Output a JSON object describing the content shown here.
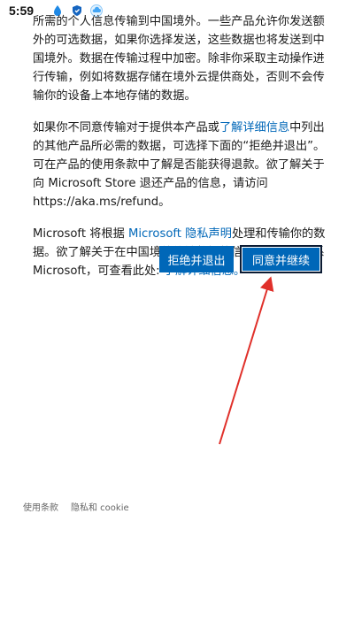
{
  "status_bar": {
    "time": "5:59",
    "icons": [
      "blue-drop-icon",
      "shield-icon",
      "cloud-badge-icon"
    ]
  },
  "content": {
    "p1": "所需的个人信息传输到中国境外。一些产品允许你发送额外的可选数据，如果你选择发送，这些数据也将发送到中国境外。数据在传输过程中加密。除非你采取主动操作进行传输，例如将数据存储在境外云提供商处，否则不会传输你的设备上本地存储的数据。",
    "p2_part1": "如果你不同意传输对于提供本产品或",
    "p2_link": "了解详细信息",
    "p2_part2": "中列出的其他产品所必需的数据，可选择下面的“拒绝并退出”。可在产品的使用条款中了解是否能获得退款。欲了解关于向 Microsoft Store 退还产品的信息，请访问 https://aka.ms/refund。",
    "p3_part1": "Microsoft 将根据 ",
    "p3_link1": "Microsoft 隐私声明",
    "p3_part2": "处理和传输你的数据。欲了解关于在中国境外传输数据的信息以及如何联系 Microsoft，可查看此处: ",
    "p3_link2": "了解详细信息。"
  },
  "buttons": {
    "decline_label": "拒绝并退出",
    "accept_label": "同意并继续"
  },
  "footer": {
    "terms": "使用条款",
    "privacy": "隐私和 cookie"
  },
  "colors": {
    "accent": "#0067b8",
    "annotation_arrow": "#e0302a"
  }
}
